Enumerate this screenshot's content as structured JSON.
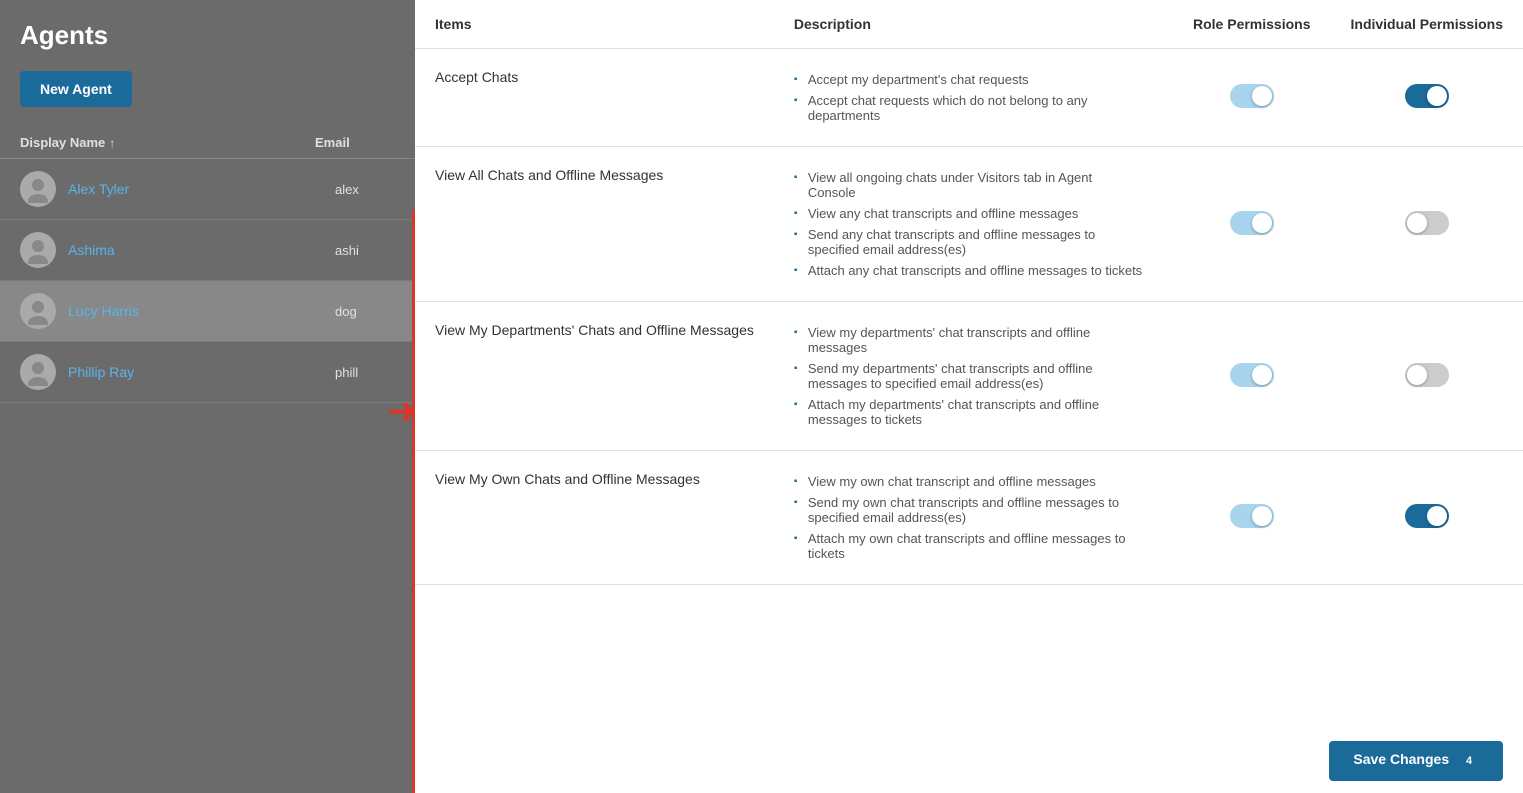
{
  "sidebar": {
    "title": "Agents",
    "new_agent_label": "New Agent",
    "column_display_name": "Display Name",
    "column_email": "Email",
    "agents": [
      {
        "id": "alex",
        "name": "Alex Tyler",
        "email": "alex",
        "selected": false
      },
      {
        "id": "ashima",
        "name": "Ashima",
        "email": "ashi",
        "selected": false
      },
      {
        "id": "lucy",
        "name": "Lucy Harris",
        "email": "dog",
        "selected": true
      },
      {
        "id": "phillip",
        "name": "Phillip Ray",
        "email": "phill",
        "selected": false
      }
    ]
  },
  "permissions": {
    "columns": {
      "items": "Items",
      "description": "Description",
      "role": "Role Permissions",
      "individual": "Individual Permissions"
    },
    "rows": [
      {
        "id": "accept-chats",
        "name": "Accept Chats",
        "descriptions": [
          "Accept my department's chat requests",
          "Accept chat requests which do not belong to any departments"
        ],
        "role_toggle": "role-partial",
        "individual_toggle": "on"
      },
      {
        "id": "view-all-chats",
        "name": "View All Chats and Offline Messages",
        "descriptions": [
          "View all ongoing chats under Visitors tab in Agent Console",
          "View any chat transcripts and offline messages",
          "Send any chat transcripts and offline messages to specified email address(es)",
          "Attach any chat transcripts and offline messages to tickets"
        ],
        "role_toggle": "role-partial",
        "individual_toggle": "off"
      },
      {
        "id": "view-my-dept-chats",
        "name": "View My Departments' Chats and Offline Messages",
        "descriptions": [
          "View my departments' chat transcripts and offline messages",
          "Send my departments' chat transcripts and offline messages to specified email address(es)",
          "Attach my departments' chat transcripts and offline messages to tickets"
        ],
        "role_toggle": "role-partial",
        "individual_toggle": "off"
      },
      {
        "id": "view-my-own-chats",
        "name": "View My Own Chats and Offline Messages",
        "descriptions": [
          "View my own chat transcript and offline messages",
          "Send my own chat transcripts and offline messages to specified email address(es)",
          "Attach my own chat transcripts and offline messages to tickets"
        ],
        "role_toggle": "role-partial",
        "individual_toggle": "on"
      }
    ]
  },
  "save_button_label": "Save Changes",
  "badge_count": "4"
}
